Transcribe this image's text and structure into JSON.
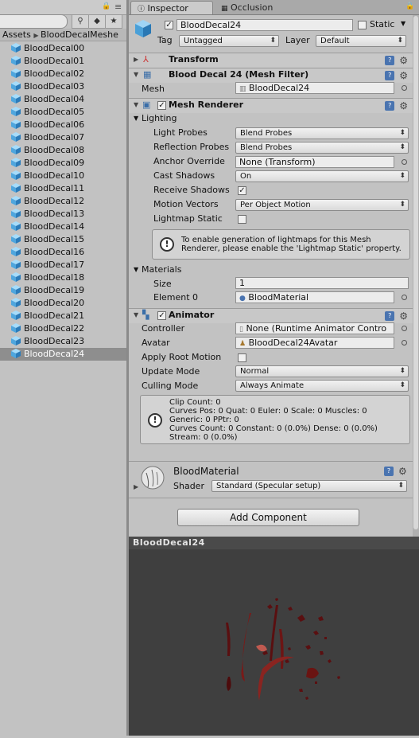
{
  "project": {
    "breadcrumb": [
      "Assets",
      "BloodDecalMeshe"
    ],
    "files": [
      "BloodDecal00",
      "BloodDecal01",
      "BloodDecal02",
      "BloodDecal03",
      "BloodDecal04",
      "BloodDecal05",
      "BloodDecal06",
      "BloodDecal07",
      "BloodDecal08",
      "BloodDecal09",
      "BloodDecal10",
      "BloodDecal11",
      "BloodDecal12",
      "BloodDecal13",
      "BloodDecal14",
      "BloodDecal15",
      "BloodDecal16",
      "BloodDecal17",
      "BloodDecal18",
      "BloodDecal19",
      "BloodDecal20",
      "BloodDecal21",
      "BloodDecal22",
      "BloodDecal23",
      "BloodDecal24"
    ],
    "selected_index": 24
  },
  "tabs": {
    "inspector": "Inspector",
    "occlusion": "Occlusion"
  },
  "object": {
    "name": "BloodDecal24",
    "static_label": "Static",
    "tag_label": "Tag",
    "tag_value": "Untagged",
    "layer_label": "Layer",
    "layer_value": "Default"
  },
  "transform": {
    "title": "Transform"
  },
  "mesh_filter": {
    "title": "Blood Decal 24 (Mesh Filter)",
    "mesh_label": "Mesh",
    "mesh_value": "BloodDecal24"
  },
  "mesh_renderer": {
    "title": "Mesh Renderer",
    "lighting": "Lighting",
    "light_probes_label": "Light Probes",
    "light_probes_value": "Blend Probes",
    "reflection_probes_label": "Reflection Probes",
    "reflection_probes_value": "Blend Probes",
    "anchor_override_label": "Anchor Override",
    "anchor_override_value": "None (Transform)",
    "cast_shadows_label": "Cast Shadows",
    "cast_shadows_value": "On",
    "receive_shadows_label": "Receive Shadows",
    "motion_vectors_label": "Motion Vectors",
    "motion_vectors_value": "Per Object Motion",
    "lightmap_static_label": "Lightmap Static",
    "info": "To enable generation of lightmaps for this Mesh Renderer, please enable the 'Lightmap Static' property.",
    "materials_label": "Materials",
    "size_label": "Size",
    "size_value": "1",
    "element0_label": "Element 0",
    "element0_value": "BloodMaterial"
  },
  "animator": {
    "title": "Animator",
    "controller_label": "Controller",
    "controller_value": "None (Runtime Animator Contro",
    "avatar_label": "Avatar",
    "avatar_value": "BloodDecal24Avatar",
    "apply_root_motion_label": "Apply Root Motion",
    "update_mode_label": "Update Mode",
    "update_mode_value": "Normal",
    "culling_mode_label": "Culling Mode",
    "culling_mode_value": "Always Animate",
    "stats": [
      "Clip Count: 0",
      "Curves Pos: 0 Quat: 0 Euler: 0 Scale: 0 Muscles: 0",
      "Generic: 0 PPtr: 0",
      "Curves Count: 0 Constant: 0 (0.0%) Dense: 0 (0.0%)",
      "Stream: 0 (0.0%)"
    ]
  },
  "material": {
    "name": "BloodMaterial",
    "shader_label": "Shader",
    "shader_value": "Standard (Specular setup)"
  },
  "add_component": "Add Component",
  "preview": {
    "title": "BloodDecal24"
  }
}
